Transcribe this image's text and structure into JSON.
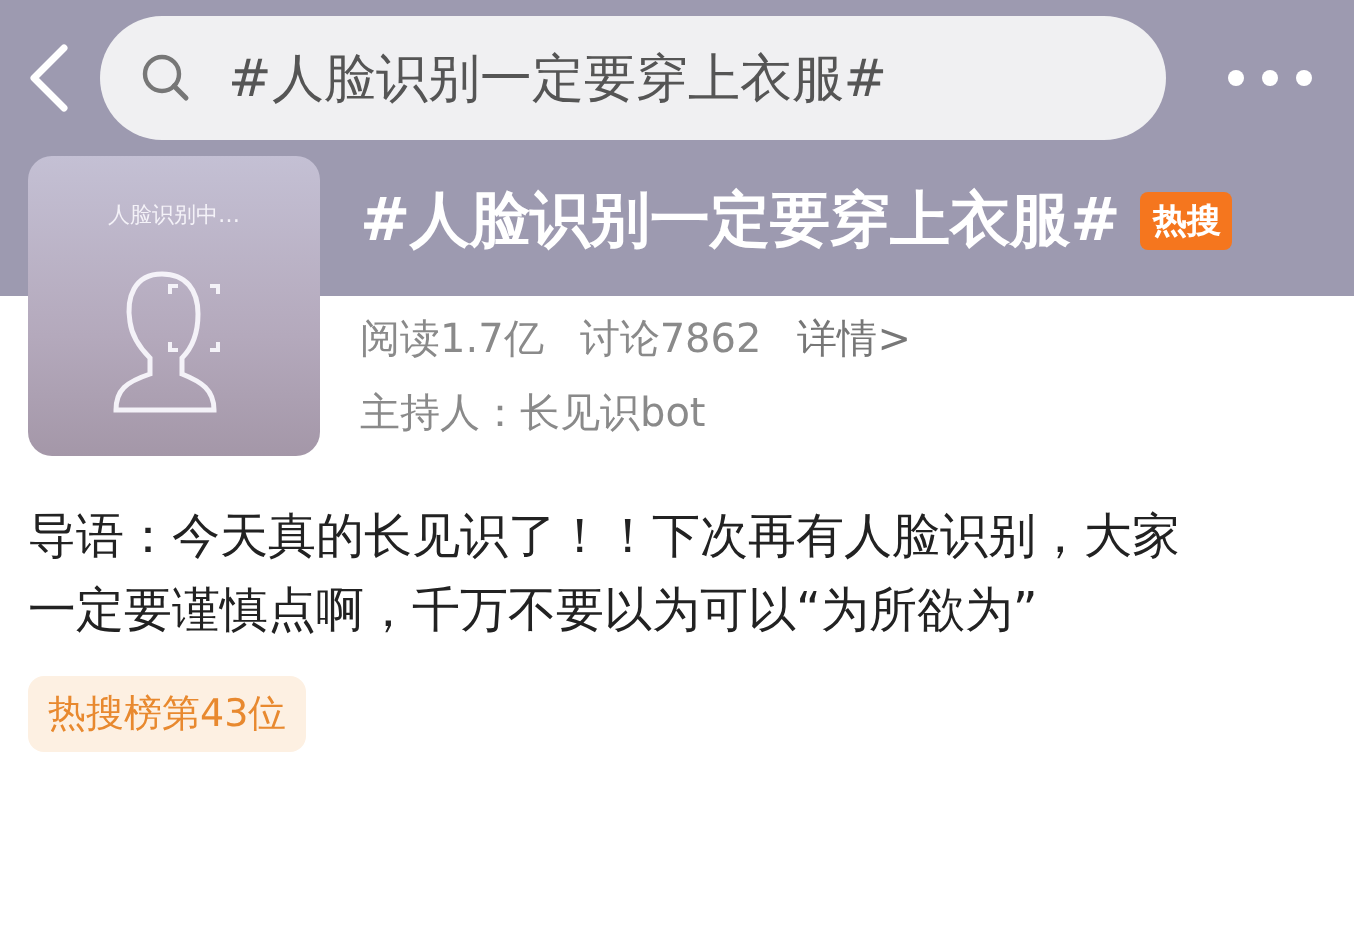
{
  "search": {
    "value": "#人脸识别一定要穿上衣服#"
  },
  "topic": {
    "thumbnail_caption": "人脸识别中…",
    "title": "#人脸识别一定要穿上衣服#",
    "badge": "热搜",
    "stats": [
      {
        "kind": "stat",
        "text": "阅读1.7亿"
      },
      {
        "kind": "stat",
        "text": "讨论7862"
      },
      {
        "kind": "link",
        "text": "详情>"
      }
    ],
    "host_label": "主持人：",
    "host_name": "长见识bot"
  },
  "intro": "导语：今天真的长见识了！！下次再有人脸识别，大家一定要谨慎点啊，千万不要以为可以“为所欲为”",
  "rank_tag": "热搜榜第43位"
}
